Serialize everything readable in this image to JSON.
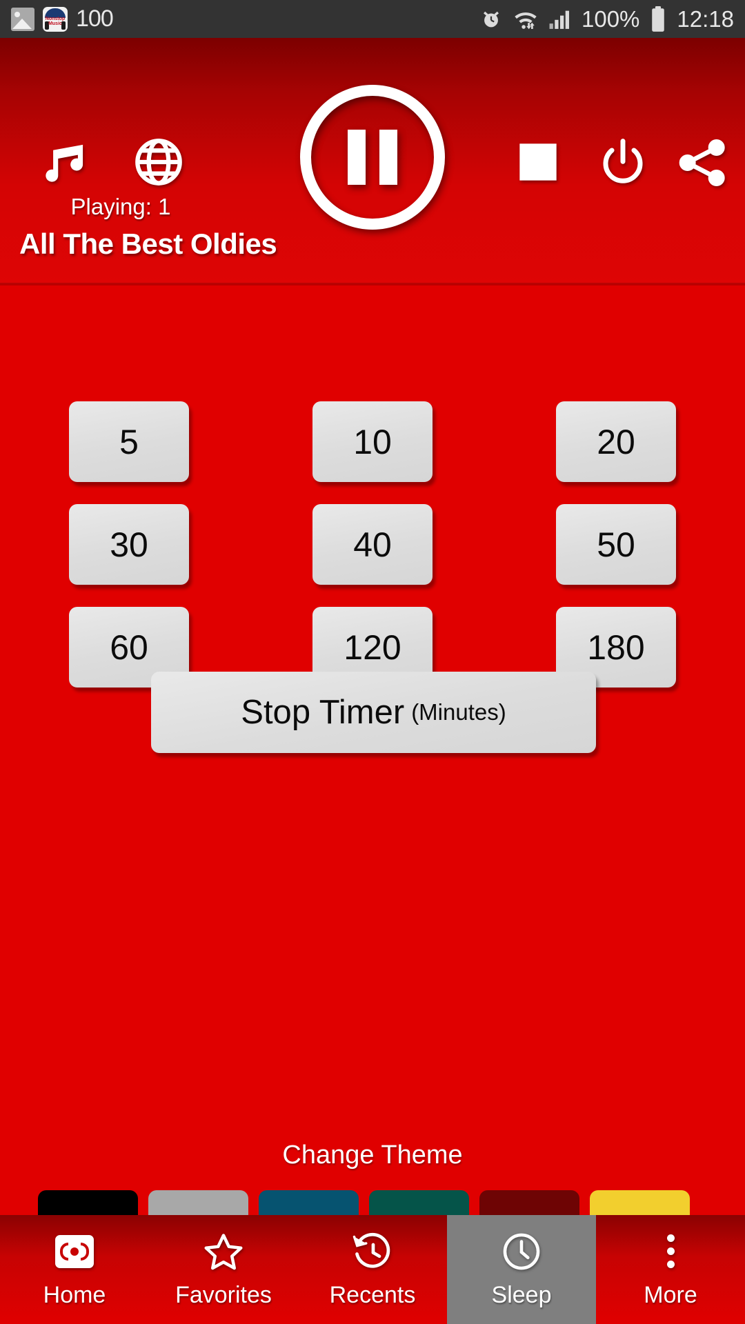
{
  "status_bar": {
    "left_icons": [
      "gallery-icon",
      "nonstop-music-app-icon"
    ],
    "app_badge_text": "Nonstop Music",
    "notification_count": "100",
    "right_icons": [
      "alarm-icon",
      "wifi-icon",
      "signal-icon",
      "battery-icon"
    ],
    "battery_percent": "100%",
    "time": "12:18"
  },
  "header": {
    "music_icon": "music-note-icon",
    "globe_icon": "globe-icon",
    "playing_label": "Playing: 1",
    "play_pause_icon": "pause-icon",
    "stop_icon": "stop-square-icon",
    "power_icon": "power-icon",
    "share_icon": "share-icon",
    "station_title": "All The Best Oldies"
  },
  "main": {
    "timer_rows": [
      [
        "5",
        "10",
        "20"
      ],
      [
        "30",
        "40",
        "50"
      ],
      [
        "60",
        "120",
        "180"
      ]
    ],
    "stop_timer": {
      "label": "Stop Timer",
      "unit": "(Minutes)"
    },
    "change_theme_label": "Change Theme",
    "theme_swatches": [
      {
        "name": "black",
        "color": "#000000"
      },
      {
        "name": "gray",
        "color": "#a8a8a8"
      },
      {
        "name": "blue",
        "color": "#065370"
      },
      {
        "name": "green",
        "color": "#055449"
      },
      {
        "name": "dark-red",
        "color": "#6e0404"
      },
      {
        "name": "yellow",
        "color": "#f2cf2e"
      }
    ]
  },
  "bottom_nav": {
    "items": [
      {
        "label": "Home",
        "icon": "radio-broadcast-icon",
        "active": false
      },
      {
        "label": "Favorites",
        "icon": "star-icon",
        "active": false
      },
      {
        "label": "Recents",
        "icon": "history-clock-icon",
        "active": false
      },
      {
        "label": "Sleep",
        "icon": "clock-icon",
        "active": true
      },
      {
        "label": "More",
        "icon": "more-vertical-icon",
        "active": false
      }
    ]
  },
  "colors": {
    "accent_red": "#e00000",
    "header_dark_red": "#7c0000",
    "status_bar": "#333333",
    "button_gray": "#dcdcdc",
    "active_nav": "#7f7f7f"
  }
}
